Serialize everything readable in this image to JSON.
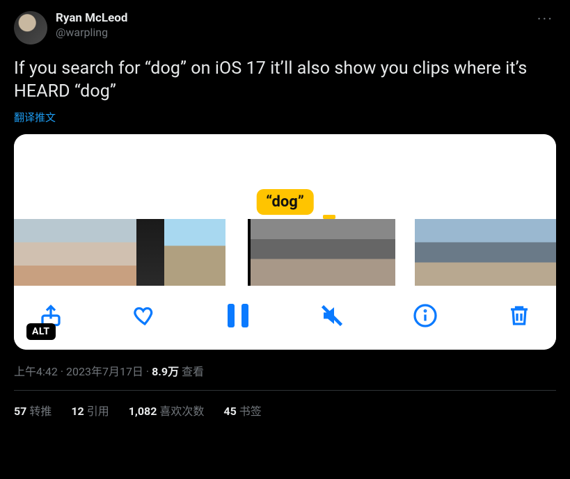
{
  "author": {
    "display_name": "Ryan McLeod",
    "handle": "@warpling"
  },
  "more_glyph": "···",
  "body": "If you search for “dog” on iOS 17 it’ll also show you clips where it’s HEARD “dog”",
  "translate_label": "翻译推文",
  "media": {
    "bubble_text": "“dog”",
    "alt_badge": "ALT",
    "toolbar": {
      "share": "share-icon",
      "like": "heart-icon",
      "pause": "pause-icon",
      "mute": "muted-icon",
      "info": "info-icon",
      "delete": "trash-icon"
    }
  },
  "meta": {
    "time": "上午4:42",
    "sep1": " · ",
    "date": "2023年7月17日",
    "sep2": " · ",
    "views_num": "8.9万",
    "views_label": " 查看"
  },
  "stats": {
    "retweets_num": "57",
    "retweets_label": "转推",
    "quotes_num": "12",
    "quotes_label": "引用",
    "likes_num": "1,082",
    "likes_label": "喜欢次数",
    "bookmarks_num": "45",
    "bookmarks_label": "书签"
  }
}
